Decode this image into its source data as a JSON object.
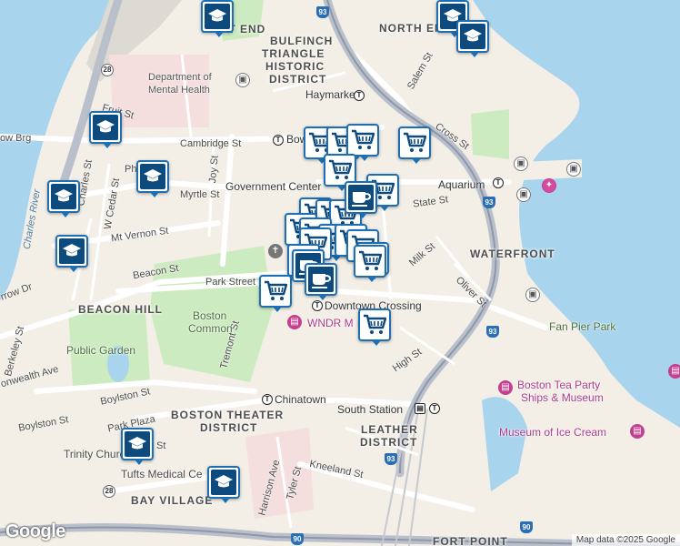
{
  "map": {
    "districts": {
      "west_end": "WEST END",
      "north_end": "NORTH END",
      "bulfinch_1": "BULFINCH",
      "bulfinch_2": "TRIANGLE",
      "bulfinch_3": "HISTORIC",
      "bulfinch_4": "DISTRICT",
      "beacon_hill": "BEACON HILL",
      "waterfront": "WATERFRONT",
      "boston_theater_1": "BOSTON THEATER",
      "boston_theater_2": "DISTRICT",
      "leather_1": "LEATHER",
      "leather_2": "DISTRICT",
      "bay_village": "BAY VILLAGE",
      "fort_point": "FORT POINT"
    },
    "streets": {
      "cambridge": "Cambridge St",
      "fruit": "Fruit St",
      "charles": "Charles St",
      "w_cedar": "W Cedar St",
      "joy": "Joy St",
      "myrtle": "Myrtle St",
      "mt_vernon": "Mt Vernon St",
      "beacon": "Beacon St",
      "park": "Park Street",
      "tremont": "Tremont St",
      "boylston": "Boylston St",
      "boylston2": "Boylston St",
      "park_plaza": "Park Plaza",
      "salem": "Salem St",
      "cross": "Cross St",
      "state": "State St",
      "milk": "Milk St",
      "oliver": "Oliver St",
      "high": "High St",
      "kneeland": "Kneeland St",
      "harrison": "Harrison Ave",
      "tyler": "Tyler St",
      "berkeley": "Berkeley St",
      "commonwealth": "onwealth Ave",
      "longfellow": "ow Brg",
      "arrow": "rrow Dr",
      "phi": "Phi",
      "st_partial": "St"
    },
    "pois": {
      "dept_mental_1": "Department of",
      "dept_mental_2": "Mental Health",
      "boston_common_1": "Boston",
      "boston_common_2": "Common",
      "public_garden": "Public Garden",
      "trinity": "Trinity Church",
      "tufts": "Tufts Medical Ce",
      "fan_pier": "Fan Pier Park",
      "tea_party_1": "Boston Tea Party",
      "tea_party_2": "Ships & Museum",
      "ice_cream": "Museum of Ice Cream",
      "wndr": "WNDR M",
      "wndr2": "m"
    },
    "transit": {
      "haymarket": "Haymarket",
      "bowdoin": "Bow",
      "gov_center": "Government Center",
      "aquarium": "Aquarium",
      "park_street": "Park Street",
      "downtown": "Downtown Crossing",
      "chinatown": "Chinatown",
      "south_station": "South Station"
    },
    "water": {
      "charles_river": "Charles River"
    },
    "highways": [
      "93",
      "93",
      "93",
      "93",
      "90",
      "90",
      "28",
      "28"
    ],
    "marker_types": [
      "school-icon",
      "cart-icon",
      "coffee-icon"
    ],
    "branding": {
      "logo": "Google",
      "attribution": "Map data ©2025 Google"
    },
    "colors": {
      "water": "#a8d4ee",
      "park": "#cdebc0",
      "land": "#f3efe6",
      "marker_border": "#1d6fb5",
      "marker_fill": "#0d4a7e"
    }
  }
}
